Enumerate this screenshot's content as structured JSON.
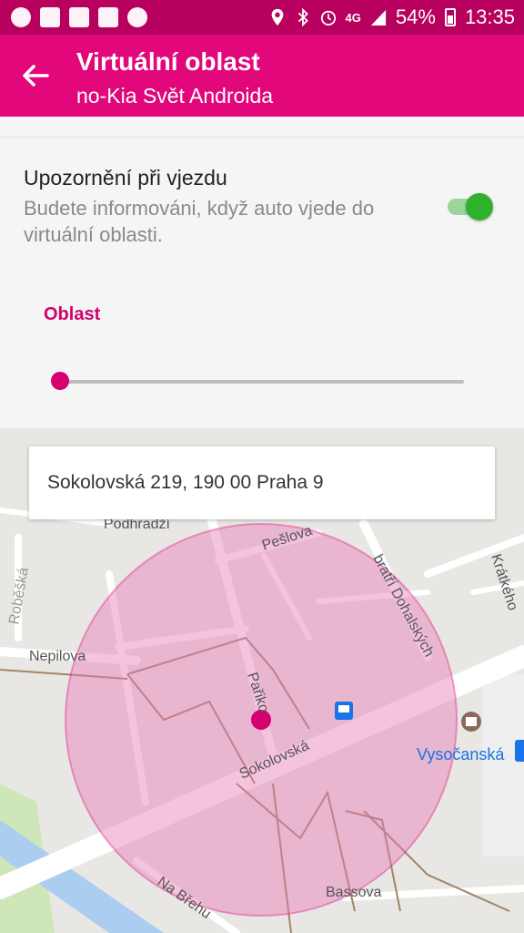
{
  "status_bar": {
    "left_icons": [
      "message-icon",
      "image-icon",
      "cast-icon",
      "wifi-icon",
      "sync-icon"
    ],
    "right_icons": [
      "location-icon",
      "bluetooth-icon",
      "alarm-icon",
      "4g-icon",
      "signal-icon"
    ],
    "network": "4G",
    "battery": "54%",
    "battery_level": 0.54,
    "time": "13:35"
  },
  "app_bar": {
    "back_icon": "arrow-back-icon",
    "title": "Virtuální oblast",
    "subtitle": "no-Kia Svět Androida"
  },
  "settings": {
    "notification_title": "Upozornění při vjezdu",
    "notification_desc": "Budete informováni, když auto vjede do virtuální oblasti.",
    "toggle_on": true,
    "area_label": "Oblast",
    "area_value": 0.0
  },
  "map": {
    "address": "Sokolovská 219, 190 00 Praha 9",
    "labels": {
      "podhradi": "Podhradží",
      "peslova": "Pešlova",
      "bratri": "bratří Dohalských",
      "kratkeho": "Krátkého",
      "robeska": "Roběšká",
      "nepilova": "Nepilova",
      "pariko": "Pařiko",
      "sokolovska": "Sokolovská",
      "vysocanska": "Vysočanská",
      "na_brehu": "Na Břehu",
      "bassova": "Bassova"
    },
    "colors": {
      "geofence": "#e77ab5",
      "marker": "#d3006e",
      "metro": "#1a73e8"
    }
  },
  "colors": {
    "accent": "#e2077a",
    "status_bar": "#b8005f",
    "toggle": "#2fb12b"
  }
}
